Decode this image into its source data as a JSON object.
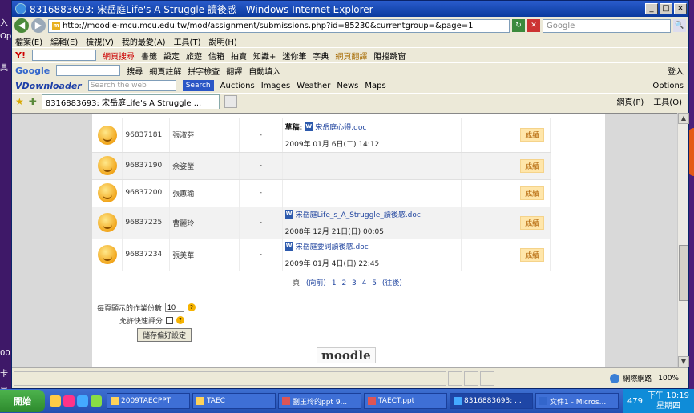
{
  "window": {
    "title": "8316883693: 宋岳庭Life's A Struggle 讀後感 - Windows Internet Explorer",
    "minimize": "_",
    "maximize": "□",
    "close": "×"
  },
  "edge_text": [
    "入",
    "Opt",
    "具",
    "00",
    "卡",
    "星"
  ],
  "address": {
    "url": "http://moodle-mcu.mcu.edu.tw/mod/assignment/submissions.php?id=85230&currentgroup=&page=1",
    "search_placeholder": "Google"
  },
  "menu": [
    "檔案(E)",
    "編輯(E)",
    "檢視(V)",
    "我的最愛(A)",
    "工具(T)",
    "說明(H)"
  ],
  "toolbar1": {
    "items": [
      "網頁搜尋",
      "書籤",
      "設定",
      "旅遊",
      "信箱",
      "拍賣",
      "知識+",
      "迷你筆",
      "字典",
      "網頁翻譯",
      "阻擋跳窗"
    ]
  },
  "toolbar2": {
    "items": [
      "搜尋",
      "網頁註解",
      "拼字檢查",
      "翻譯",
      "自動填入"
    ],
    "right": [
      "登入"
    ]
  },
  "toolbar3": {
    "logo": "VDownloader",
    "search_placeholder": "Search the web",
    "search_button": "Search",
    "items": [
      "Auctions",
      "Images",
      "Weather",
      "News",
      "Maps"
    ],
    "options": "Options"
  },
  "tabs": {
    "active": "8316883693: 宋岳庭Life's A Struggle ...",
    "right": [
      "網頁(P)",
      "工具(O)"
    ]
  },
  "submissions": [
    {
      "id": "96837181",
      "name": "張淑芬",
      "dash": "-",
      "file": "宋岳庭心得.doc",
      "draft": "草稿:",
      "time": "2009年 01月 6日(二) 14:12",
      "grade": "成績"
    },
    {
      "id": "96837190",
      "name": "余姿瑩",
      "dash": "-",
      "file": "",
      "draft": "",
      "time": "",
      "grade": "成績"
    },
    {
      "id": "96837200",
      "name": "張蕙瑜",
      "dash": "-",
      "file": "",
      "draft": "",
      "time": "",
      "grade": "成績"
    },
    {
      "id": "96837225",
      "name": "曹麗玲",
      "dash": "-",
      "file": "宋岳庭Life_s_A_Struggle_讀後感.doc",
      "draft": "",
      "time": "2008年 12月 21日(日) 00:05",
      "grade": "成績"
    },
    {
      "id": "96837234",
      "name": "張美華",
      "dash": "-",
      "file": "宋岳庭要詞讀後感.doc",
      "draft": "",
      "time": "2009年 01月 4日(日) 22:45",
      "grade": "成績"
    }
  ],
  "pager": {
    "label": "頁:",
    "prev": "(向前)",
    "pages": [
      "1",
      "2",
      "3",
      "4",
      "5"
    ],
    "next": "(往後)"
  },
  "prefs": {
    "per_page_label": "每頁顯示的作業份數",
    "per_page_value": "10",
    "quick_grade_label": "允許快速評分",
    "save_button": "儲存偏好設定"
  },
  "footer_logo": "moodle",
  "status": {
    "zone": "網際網路",
    "zoom": "100%"
  },
  "taskbar": {
    "start": "開始",
    "tasks": [
      "2009TAECPPT",
      "TAEC",
      "劉玉玲的ppt 9...",
      "TAECT.ppt",
      "8316883693: ...",
      "文件1 - Micros..."
    ],
    "clock_time": "下午 10:19",
    "clock_day": "星期四",
    "tray_number": "479"
  }
}
